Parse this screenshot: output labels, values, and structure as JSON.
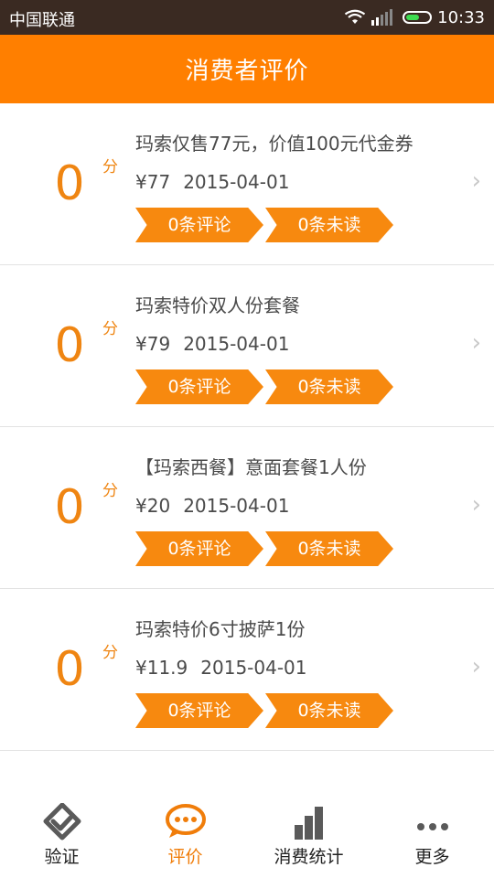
{
  "status_bar": {
    "carrier": "中国联通",
    "time": "10:33",
    "battery_level": 0.5
  },
  "header": {
    "title": "消费者评价"
  },
  "items": [
    {
      "score": "0",
      "unit": "分",
      "name": "玛索仅售77元，价值100元代金券",
      "price": "¥77",
      "date": "2015-04-01",
      "reviews": "0条评论",
      "unread": "0条未读"
    },
    {
      "score": "0",
      "unit": "分",
      "name": "玛索特价双人份套餐",
      "price": "¥79",
      "date": "2015-04-01",
      "reviews": "0条评论",
      "unread": "0条未读"
    },
    {
      "score": "0",
      "unit": "分",
      "name": "【玛索西餐】意面套餐1人份",
      "price": "¥20",
      "date": "2015-04-01",
      "reviews": "0条评论",
      "unread": "0条未读"
    },
    {
      "score": "0",
      "unit": "分",
      "name": "玛索特价6寸披萨1份",
      "price": "¥11.9",
      "date": "2015-04-01",
      "reviews": "0条评论",
      "unread": "0条未读"
    }
  ],
  "chevron": "›",
  "nav": [
    {
      "label": "验证",
      "icon": "verify-icon"
    },
    {
      "label": "评价",
      "icon": "review-chat-icon",
      "active": true
    },
    {
      "label": "消费统计",
      "icon": "bar-chart-icon"
    },
    {
      "label": "更多",
      "icon": "more-dots-icon"
    }
  ],
  "colors": {
    "accent": "#ff7f00",
    "tag": "#f7890f",
    "score": "#ef8512",
    "status_bar": "#3a2a22"
  }
}
